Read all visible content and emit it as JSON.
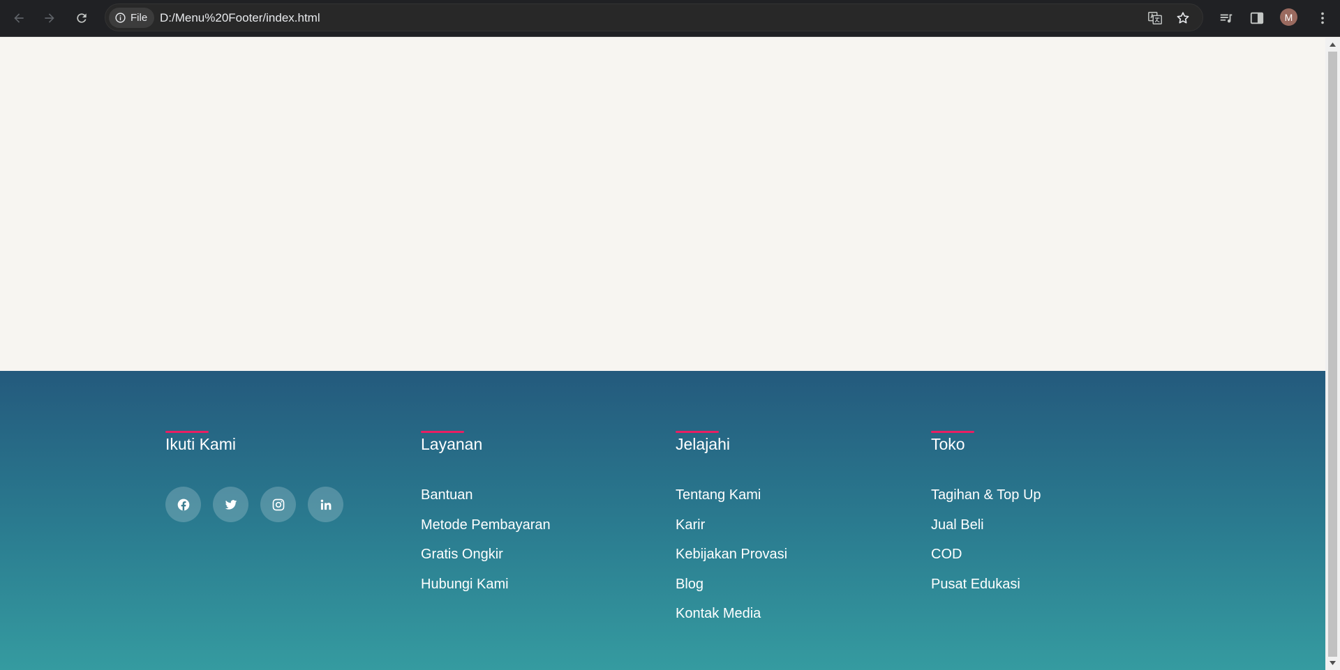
{
  "browser": {
    "site_chip_label": "File",
    "url": "D:/Menu%20Footer/index.html",
    "profile_initial": "M",
    "icons": [
      "back-icon",
      "forward-icon",
      "reload-icon",
      "info-icon",
      "translate-icon",
      "bookmark-star-icon",
      "media-playlist-icon",
      "side-panel-icon",
      "menu-dots-icon"
    ]
  },
  "footer": {
    "columns": [
      {
        "heading": "Ikuti Kami",
        "socials": [
          "facebook-icon",
          "twitter-icon",
          "instagram-icon",
          "linkedin-icon"
        ]
      },
      {
        "heading": "Layanan",
        "links": [
          "Bantuan",
          "Metode Pembayaran",
          "Gratis Ongkir",
          "Hubungi Kami"
        ]
      },
      {
        "heading": "Jelajahi",
        "links": [
          "Tentang Kami",
          "Karir",
          "Kebijakan Provasi",
          "Blog",
          "Kontak Media"
        ]
      },
      {
        "heading": "Toko",
        "links": [
          "Tagihan & Top Up",
          "Jual Beli",
          "COD",
          "Pusat Edukasi"
        ]
      }
    ]
  },
  "colors": {
    "page_background": "#f7f5f1",
    "footer_gradient_top": "#245a7d",
    "footer_gradient_bottom": "#359ba0",
    "heading_accent": "#e91e63",
    "chrome_background": "#202124"
  }
}
